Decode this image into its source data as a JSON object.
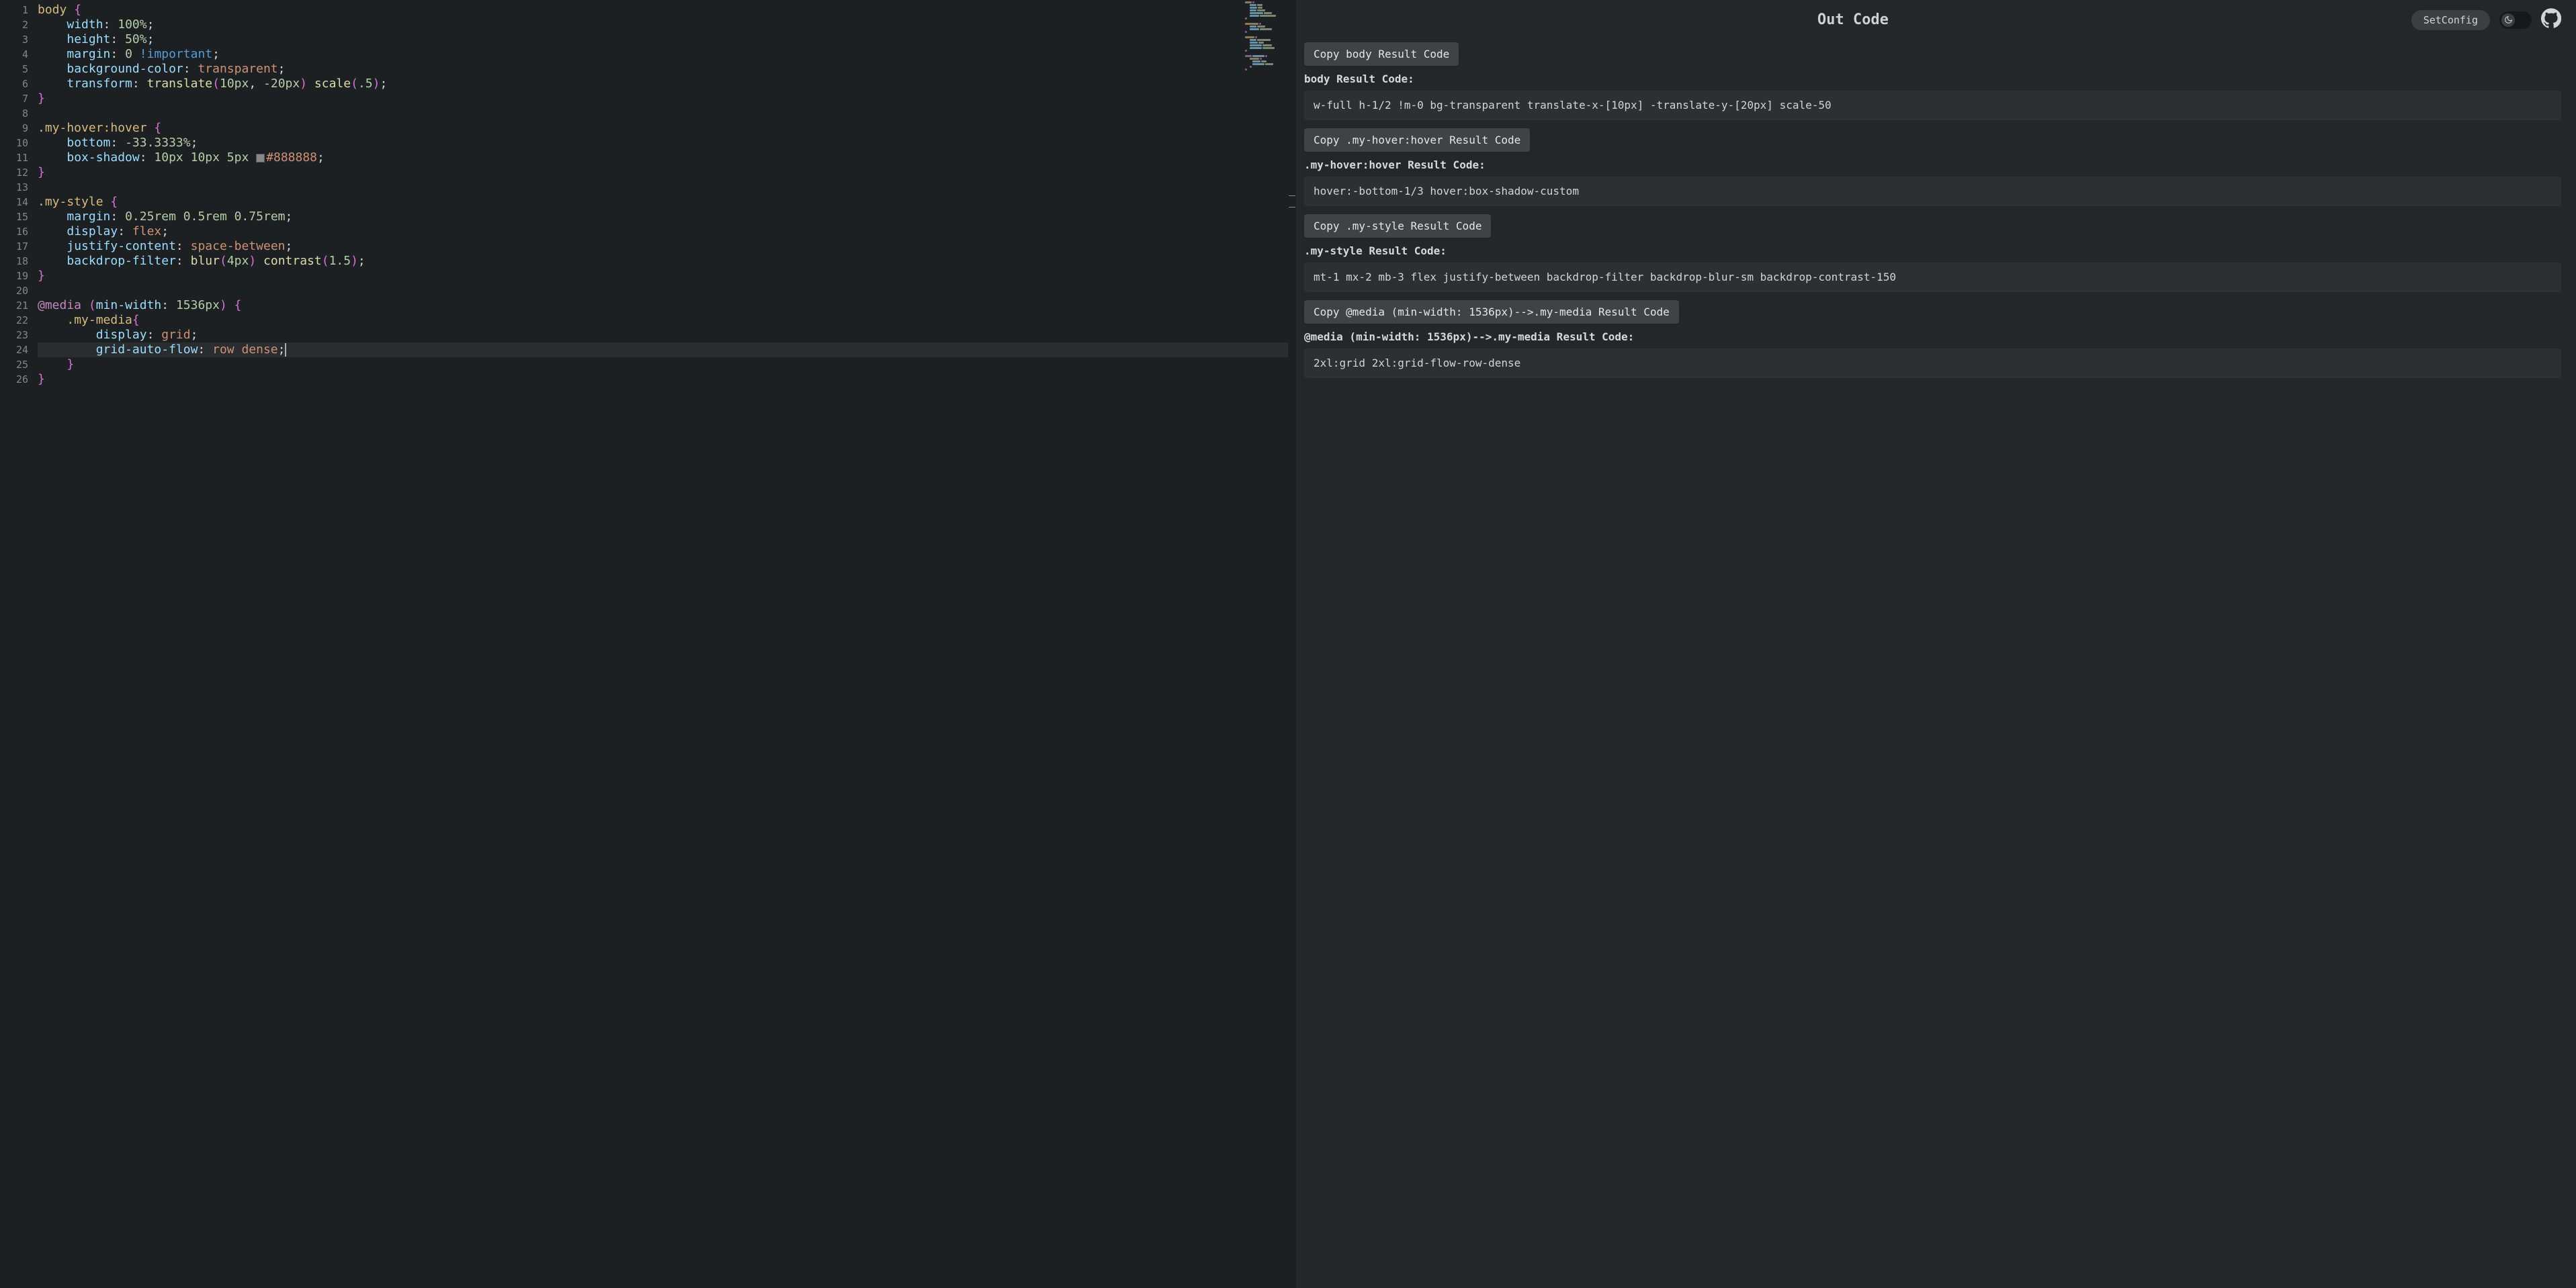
{
  "title": "Out Code",
  "set_config_label": "SetConfig",
  "editor": {
    "lines": 26,
    "current_line": 24
  },
  "code": {
    "l1_sel": "body",
    "l1_brace": "{",
    "l2_prop": "width",
    "l2_val": "100%",
    "l2_semi": ";",
    "l3_prop": "height",
    "l3_val": "50%",
    "l3_semi": ";",
    "l4_prop": "margin",
    "l4_val": "0",
    "l4_imp": "!important",
    "l4_semi": ";",
    "l5_prop": "background-color",
    "l5_val": "transparent",
    "l5_semi": ";",
    "l6_prop": "transform",
    "l6_fn1": "translate",
    "l6_arg1a": "10px",
    "l6_comma": ", ",
    "l6_arg1b": "-20px",
    "l6_fn2": "scale",
    "l6_arg2": ".5",
    "l6_semi": ";",
    "l7_brace": "}",
    "l9_sel": ".my-hover:hover",
    "l9_brace": "{",
    "l10_prop": "bottom",
    "l10_val": "-33.3333%",
    "l10_semi": ";",
    "l11_prop": "box-shadow",
    "l11_val": "10px 10px 5px",
    "l11_color": "#888888",
    "l11_semi": ";",
    "l12_brace": "}",
    "l14_sel": ".my-style",
    "l14_brace": "{",
    "l15_prop": "margin",
    "l15_val": "0.25rem 0.5rem 0.75rem",
    "l15_semi": ";",
    "l16_prop": "display",
    "l16_val": "flex",
    "l16_semi": ";",
    "l17_prop": "justify-content",
    "l17_val": "space-between",
    "l17_semi": ";",
    "l18_prop": "backdrop-filter",
    "l18_fn1": "blur",
    "l18_arg1": "4px",
    "l18_fn2": "contrast",
    "l18_arg2": "1.5",
    "l18_semi": ";",
    "l19_brace": "}",
    "l21_kw": "@media",
    "l21_lp": "(",
    "l21_prop": "min-width",
    "l21_val": "1536px",
    "l21_rp": ")",
    "l21_brace": "{",
    "l22_sel": ".my-media",
    "l22_brace": "{",
    "l23_prop": "display",
    "l23_val": "grid",
    "l23_semi": ";",
    "l24_prop": "grid-auto-flow",
    "l24_val": "row dense",
    "l24_semi": ";",
    "l25_brace": "}",
    "l26_brace": "}"
  },
  "output": [
    {
      "copy_label": "Copy body Result Code",
      "title": "body Result Code:",
      "result": "w-full h-1/2 !m-0 bg-transparent translate-x-[10px] -translate-y-[20px] scale-50"
    },
    {
      "copy_label": "Copy .my-hover:hover Result Code",
      "title": ".my-hover:hover Result Code:",
      "result": "hover:-bottom-1/3 hover:box-shadow-custom"
    },
    {
      "copy_label": "Copy .my-style Result Code",
      "title": ".my-style Result Code:",
      "result": "mt-1 mx-2 mb-3 flex justify-between backdrop-filter backdrop-blur-sm backdrop-contrast-150"
    },
    {
      "copy_label": "Copy @media (min-width: 1536px)-->.my-media Result Code",
      "title": "@media (min-width: 1536px)-->.my-media Result Code:",
      "result": "2xl:grid 2xl:grid-flow-row-dense"
    }
  ]
}
